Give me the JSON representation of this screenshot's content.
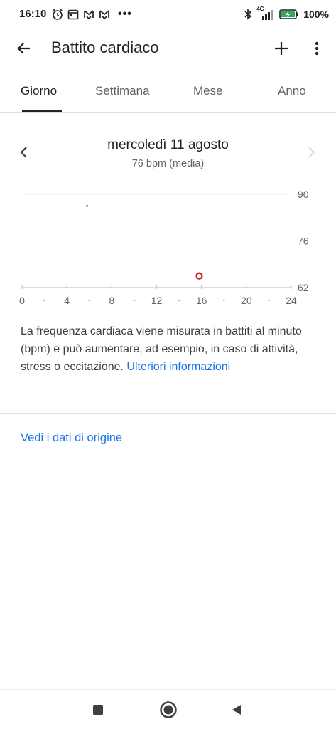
{
  "status_bar": {
    "time": "16:10",
    "battery_text": "100",
    "battery_percent_suffix": "%",
    "network_label": "4G",
    "icons_left": [
      "alarm-icon",
      "calendar-icon",
      "notification-icon",
      "notification-icon"
    ],
    "icons_right": [
      "bluetooth-icon",
      "signal-icon",
      "battery-charging-icon"
    ]
  },
  "app_bar": {
    "title": "Battito cardiaco",
    "back_icon": "arrow-back-icon",
    "add_icon": "add-icon",
    "more_icon": "more-vert-icon"
  },
  "tabs": [
    {
      "label": "Giorno",
      "active": true
    },
    {
      "label": "Settimana",
      "active": false
    },
    {
      "label": "Mese",
      "active": false
    },
    {
      "label": "Anno",
      "active": false
    }
  ],
  "date_header": {
    "title": "mercoledì 11 agosto",
    "subtitle": "76 bpm (media)"
  },
  "chart_data": {
    "type": "scatter",
    "x_ticks": [
      "0",
      "4",
      "8",
      "12",
      "16",
      "20",
      "24"
    ],
    "y_ticks": [
      "90",
      "76",
      "62"
    ],
    "xlim": [
      0,
      24
    ],
    "ylim": [
      62,
      90
    ],
    "grid": true,
    "points": [
      {
        "x": 5.8,
        "y": 86.5,
        "style": "dot"
      },
      {
        "x": 15.8,
        "y": 65.5,
        "style": "ring"
      }
    ],
    "point_color": "#c5221f"
  },
  "description": {
    "text": "La frequenza cardiaca viene misurata in battiti al minuto (bpm) e può aumentare, ad esempio, in caso di attività, stress o eccitazione. ",
    "link": "Ulteriori informazioni"
  },
  "source_link": "Vedi i dati di origine",
  "colors": {
    "accent": "#1a73e8",
    "text": "#202124",
    "secondary": "#5f6368",
    "point": "#c5221f"
  },
  "nav_bar": {
    "icons": [
      "recents-icon",
      "home-icon",
      "back-icon"
    ]
  }
}
